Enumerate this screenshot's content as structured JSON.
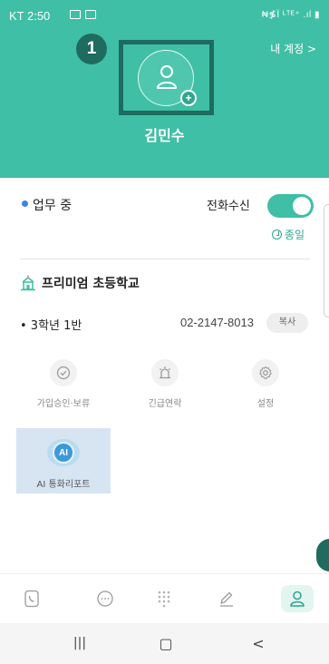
{
  "status_bar": {
    "time": "KT 2:50",
    "right_icons": "₦≸Ϊ ᴸᵀᴱ⁺ .ıl ▮"
  },
  "header": {
    "step_number": "1",
    "my_account_label": "내 계정 >",
    "user_name": "김민수",
    "avatar_add_symbol": "+",
    "background_color": "#3fbfa5"
  },
  "work": {
    "status_label": "업무 중",
    "call_receive_label": "전화수신",
    "call_receive_on": true,
    "end_label": "종일"
  },
  "school": {
    "name": "프리미엄 초등학교",
    "class_name": "• 3학년 1반",
    "phone": "02-2147-8013",
    "copy_label": "복사"
  },
  "menu": {
    "approval_label": "가입승인·보류",
    "emergency_label": "긴급연락",
    "settings_label": "설정",
    "report_label": "AI 통화리포트",
    "report_icon_text": "AI"
  },
  "bottom_nav": {
    "items": [
      "phone-icon",
      "chat-icon",
      "keypad-icon",
      "edit-icon",
      "profile-icon"
    ],
    "active": "profile-icon"
  },
  "system_nav": {
    "recent_symbol": "|||",
    "home_symbol": "▢",
    "back_symbol": "<"
  }
}
